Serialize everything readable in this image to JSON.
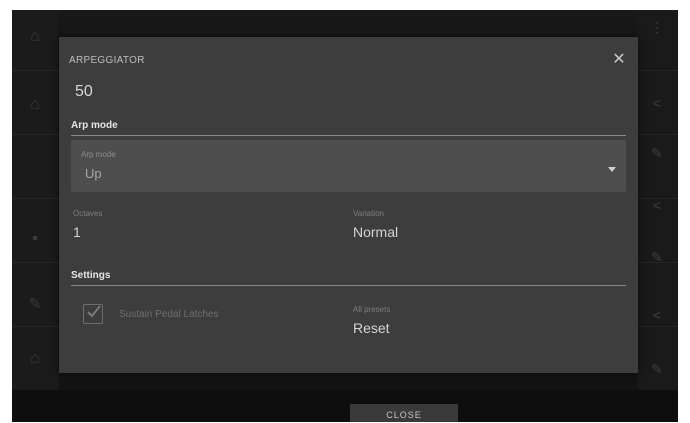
{
  "dialog": {
    "title": "ARPEGGIATOR",
    "value": "50",
    "arp_mode": {
      "header": "Arp mode",
      "select_label": "Arp mode",
      "select_value": "Up"
    },
    "octaves": {
      "label": "Octaves",
      "value": "1"
    },
    "variation": {
      "label": "Variation",
      "value": "Normal"
    },
    "settings": {
      "header": "Settings",
      "checkbox_label": "Sustain Pedal Latches",
      "checkbox_checked": true,
      "all_presets": {
        "label": "All presets",
        "value": "Reset"
      }
    }
  },
  "footer": {
    "close_label": "CLOSE"
  },
  "icons": {
    "close": "close-icon",
    "dropdown": "chevron-down-icon",
    "check": "check-icon"
  }
}
